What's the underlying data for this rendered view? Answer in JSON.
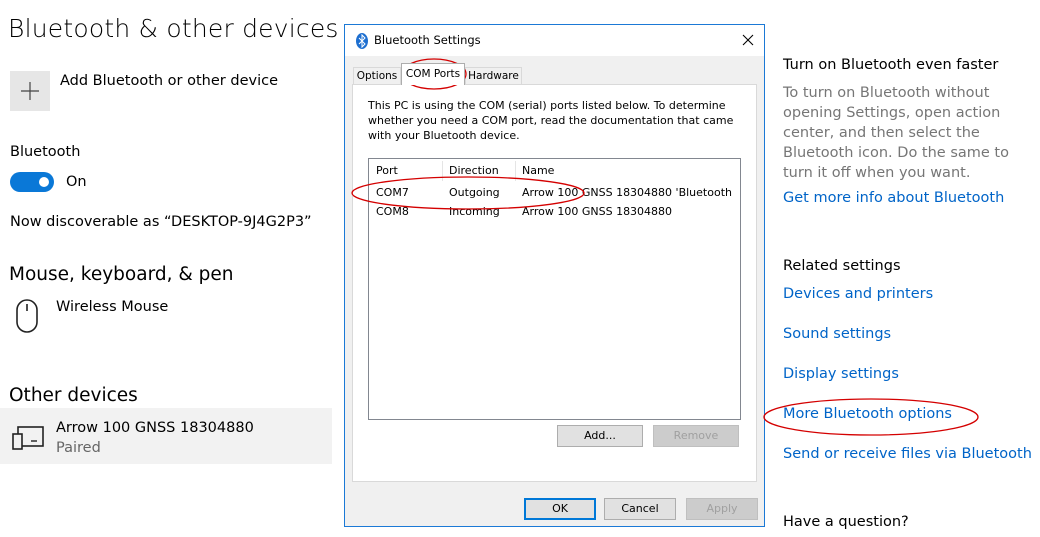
{
  "settings": {
    "page_title": "Bluetooth & other devices",
    "add_device_label": "Add Bluetooth or other device",
    "bluetooth_label": "Bluetooth",
    "toggle_state": "On",
    "discoverable_text": "Now discoverable as “DESKTOP-9J4G2P3”",
    "mouse_section_title": "Mouse, keyboard, & pen",
    "mouse_device_name": "Wireless Mouse",
    "other_section_title": "Other devices",
    "other_device_name": "Arrow 100 GNSS 18304880",
    "other_device_status": "Paired",
    "accent_color": "#0a78d7"
  },
  "right_column": {
    "faster_title": "Turn on Bluetooth even faster",
    "faster_text": "To turn on Bluetooth without opening Settings, open action center, and then select the Bluetooth icon. Do the same to turn it off when you want.",
    "more_info_link": "Get more info about Bluetooth",
    "related_title": "Related settings",
    "links": [
      "Devices and printers",
      "Sound settings",
      "Display settings",
      "More Bluetooth options",
      "Send or receive files via Bluetooth"
    ],
    "question_title": "Have a question?",
    "link_color": "#0064c8"
  },
  "dialog": {
    "title": "Bluetooth Settings",
    "tabs": [
      "Options",
      "COM Ports",
      "Hardware"
    ],
    "active_tab": "COM Ports",
    "description": "This PC is using the COM (serial) ports listed below. To determine whether you need a COM port, read the documentation that came with your Bluetooth device.",
    "columns": [
      "Port",
      "Direction",
      "Name"
    ],
    "rows": [
      {
        "port": "COM7",
        "direction": "Outgoing",
        "name": "Arrow 100 GNSS 18304880 'Bluetooth ..."
      },
      {
        "port": "COM8",
        "direction": "Incoming",
        "name": "Arrow 100 GNSS 18304880"
      }
    ],
    "add_button": "Add...",
    "remove_button": "Remove",
    "ok_button": "OK",
    "cancel_button": "Cancel",
    "apply_button": "Apply"
  },
  "annotation_color": "#d40000"
}
